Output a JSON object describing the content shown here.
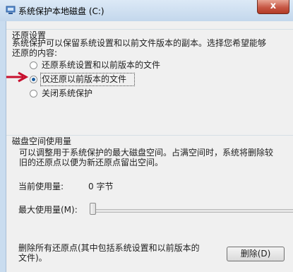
{
  "window": {
    "title": "系统保护本地磁盘 (C:)",
    "close_label": "x"
  },
  "restore": {
    "group_title": "还原设置",
    "description_line1": "系统保护可以保留系统设置和以前文件版本的副本。选择您希望能够",
    "description_line2": "还原的内容:",
    "options": [
      {
        "label": "还原系统设置和以前版本的文件",
        "checked": false
      },
      {
        "label": "仅还原以前版本的文件",
        "checked": true
      },
      {
        "label": "关闭系统保护",
        "checked": false
      }
    ]
  },
  "disk": {
    "group_title": "磁盘空间使用量",
    "description_line1": "可以调整用于系统保护的最大磁盘空间。占满空间时，系统将删除较",
    "description_line2": "旧的还原点以便为新还原点留出空间。",
    "current_usage_label": "当前使用量:",
    "current_usage_value": "0 字节",
    "max_usage_label": "最大使用量(M):",
    "max_usage_fraction": 0
  },
  "delete": {
    "text_line1": "删除所有还原点(其中包括系统设置和以前版本的",
    "text_line2": "文件)。",
    "button_label": "删除(D)"
  },
  "colors": {
    "arrow": "#c8102e",
    "accent": "#1c5e9f"
  }
}
